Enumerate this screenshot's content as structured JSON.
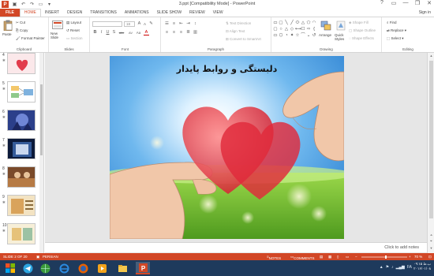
{
  "window": {
    "title": "3.ppt [Compatibility Mode] - PowerPoint",
    "app_badge": "P",
    "help": "?",
    "minimize": "—",
    "restore": "❐",
    "close": "✕"
  },
  "tabs": [
    "FILE",
    "HOME",
    "INSERT",
    "DESIGN",
    "TRANSITIONS",
    "ANIMATIONS",
    "SLIDE SHOW",
    "REVIEW",
    "VIEW"
  ],
  "active_tab": "HOME",
  "sign_in": "Sign in",
  "ribbon": {
    "clipboard": {
      "label": "Clipboard",
      "paste": "Paste",
      "cut": "Cut",
      "copy": "Copy",
      "format_painter": "Format Painter"
    },
    "slides": {
      "label": "Slides",
      "new_slide": "New Slide",
      "layout": "Layout",
      "reset": "Reset",
      "section": "Section"
    },
    "font": {
      "label": "Font",
      "font_name": "",
      "font_size": "18",
      "bold": "B",
      "italic": "I",
      "underline": "U",
      "strike": "S",
      "shadow": "abc",
      "spacing": "AV",
      "case": "Aa",
      "color": "A",
      "grow": "A",
      "shrink": "A",
      "clear": "✎"
    },
    "paragraph": {
      "label": "Paragraph",
      "text_direction": "Text Direction",
      "align_text": "Align Text",
      "convert_smartart": "Convert to SmartArt"
    },
    "drawing": {
      "label": "Drawing",
      "arrange": "Arrange",
      "quick_styles": "Quick Styles",
      "shape_fill": "Shape Fill",
      "shape_outline": "Shape Outline",
      "shape_effects": "Shape Effects",
      "shapes": [
        "▭",
        "▢",
        "╲",
        "╱",
        "⬭",
        "△",
        "⬠",
        "◠",
        "▢",
        "○",
        "△",
        "◇",
        "⟷",
        "☐",
        "⇨",
        "{",
        "▭",
        "⬡",
        "◔",
        "✦",
        "☆",
        "⌒",
        "⌄",
        "↺"
      ]
    },
    "editing": {
      "label": "Editing",
      "find": "Find",
      "replace": "Replace",
      "select": "Select"
    }
  },
  "slides": [
    {
      "num": "4"
    },
    {
      "num": "5"
    },
    {
      "num": "6"
    },
    {
      "num": "7"
    },
    {
      "num": "8"
    },
    {
      "num": "9"
    },
    {
      "num": "10"
    }
  ],
  "slide": {
    "title": "دلبستگی و روابط پایدار"
  },
  "notes": "Click to add notes",
  "status": {
    "slide_of": "SLIDE 2 OF 20",
    "language": "PERSIAN",
    "notes": "NOTES",
    "comments": "COMMENTS",
    "zoom": "70 %"
  },
  "taskbar": {
    "lang": "FA",
    "time": "۰۹:۱۵ ب.ظ",
    "date": "۲۰۱۶/۰۱/۰۸"
  },
  "colors": {
    "accent": "#d24726",
    "taskbar": "#1e3a5c"
  }
}
